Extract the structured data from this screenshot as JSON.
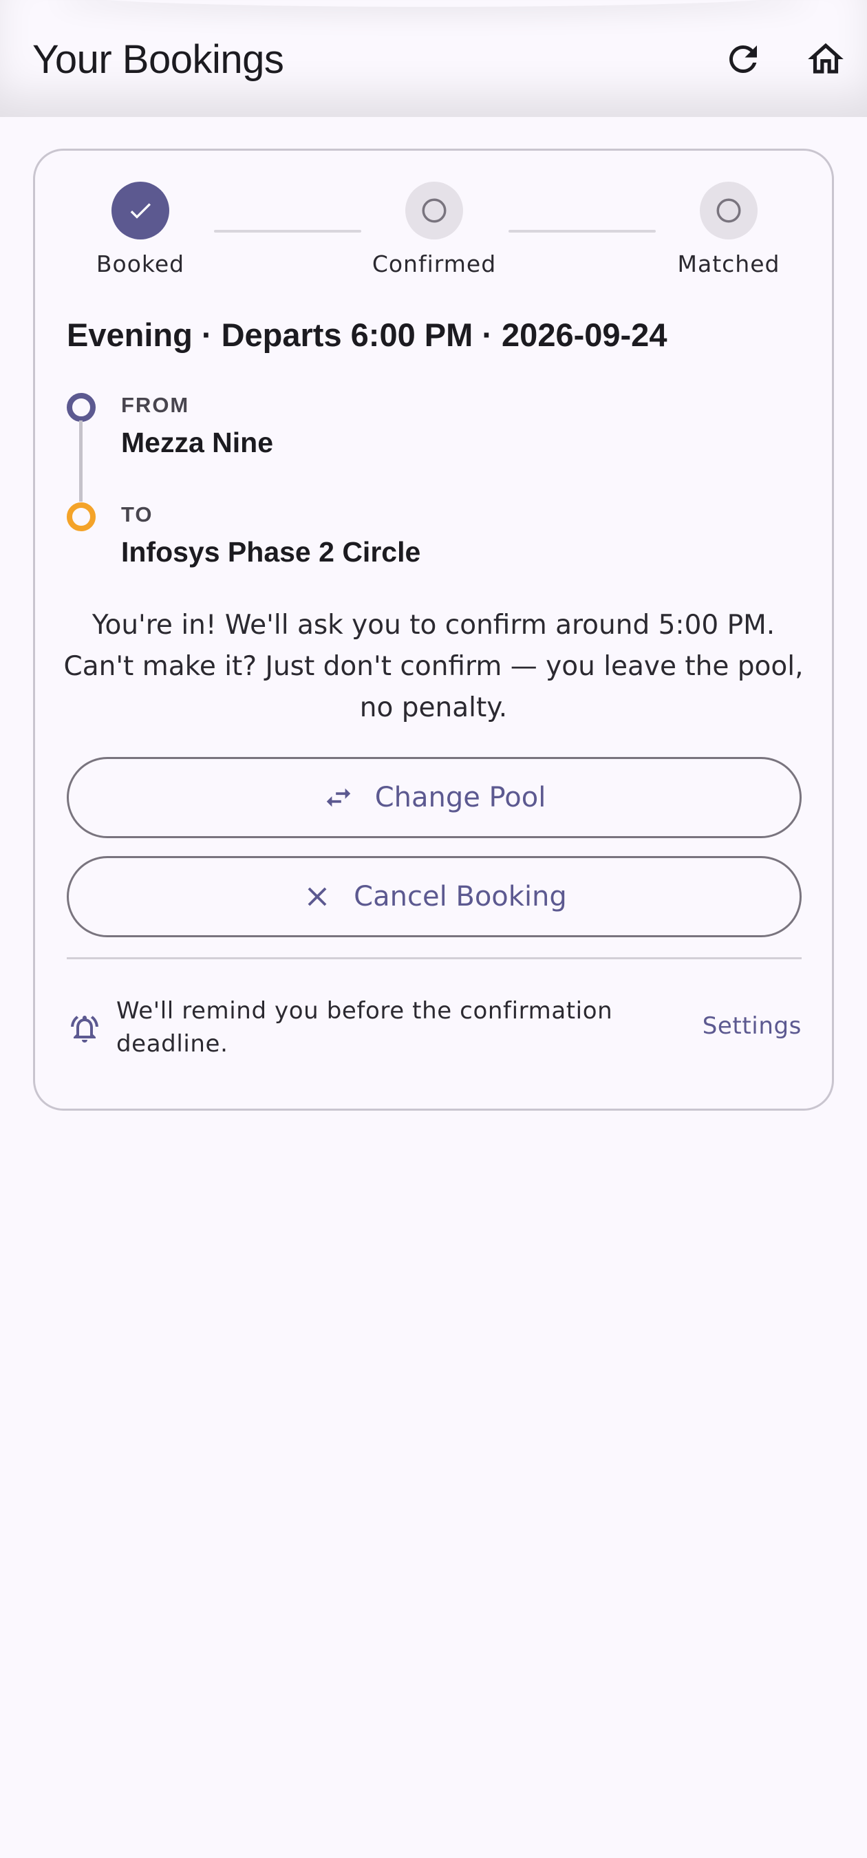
{
  "app_bar": {
    "title": "Your Bookings",
    "refresh_icon": "refresh-icon",
    "home_icon": "home-icon"
  },
  "stepper": {
    "steps": [
      {
        "label": "Booked",
        "state": "done"
      },
      {
        "label": "Confirmed",
        "state": "pending"
      },
      {
        "label": "Matched",
        "state": "pending"
      }
    ]
  },
  "booking": {
    "heading": "Evening · Departs 6:00 PM · 2026-09-24",
    "from_label": "FROM",
    "from_value": "Mezza Nine",
    "to_label": "TO",
    "to_value": "Infosys Phase 2 Circle",
    "message": "You're in! We'll ask you to confirm around 5:00 PM. Can't make it? Just don't confirm — you leave the pool, no penalty."
  },
  "actions": {
    "change_pool_label": "Change Pool",
    "change_pool_icon": "swap-horizontal-icon",
    "cancel_label": "Cancel Booking",
    "cancel_icon": "close-icon"
  },
  "reminder": {
    "text": "We'll remind you before the confirmation deadline.",
    "settings_label": "Settings",
    "icon": "bell-ring-icon"
  },
  "colors": {
    "background": "#FBF8FE",
    "primary": "#5C5990",
    "from_dot": "#5C5990",
    "to_dot": "#F4A329",
    "outline": "#79747E"
  }
}
